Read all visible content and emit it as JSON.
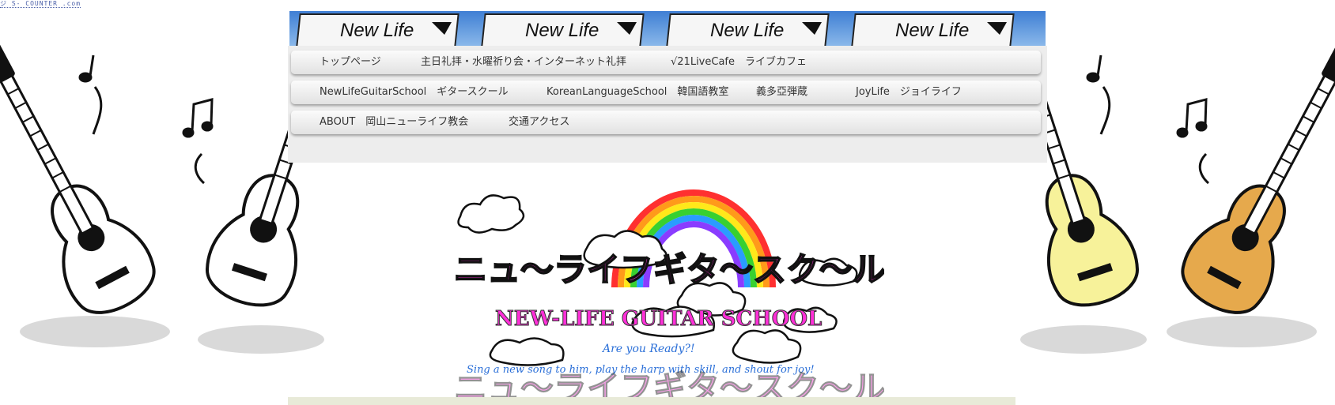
{
  "counter": {
    "text": "ジ S- COUNTER .com"
  },
  "banner": {
    "sign_text": "New Life"
  },
  "nav": {
    "row1": [
      "トップページ",
      "主日礼拝・水曜祈り会・インターネット礼拝",
      "√21LiveCafe　ライブカフェ"
    ],
    "row2": [
      "NewLifeGuitarSchool　ギタースクール",
      "KoreanLanguageSchool　韓国語教室",
      "義多亞弾蔵",
      "JoyLife　ジョイライフ"
    ],
    "row3": [
      "ABOUT　岡山ニューライフ教会",
      "交通アクセス"
    ]
  },
  "hero": {
    "title_jp": "ニュ〜ライフギタ〜スク〜ル!!",
    "title_en": "NEW-LIFE GUITAR SCHOOL",
    "tagline1": "Are you Ready?!",
    "tagline2": "Sing a new song to him, play the harp with skill, and shout for joy!"
  },
  "colors": {
    "title_magenta": "#ff2fd8",
    "tagline_blue": "#2a6fd8",
    "nav_text": "#333333",
    "guitar_yellow": "#f7f29a",
    "guitar_orange": "#e6a94c"
  }
}
